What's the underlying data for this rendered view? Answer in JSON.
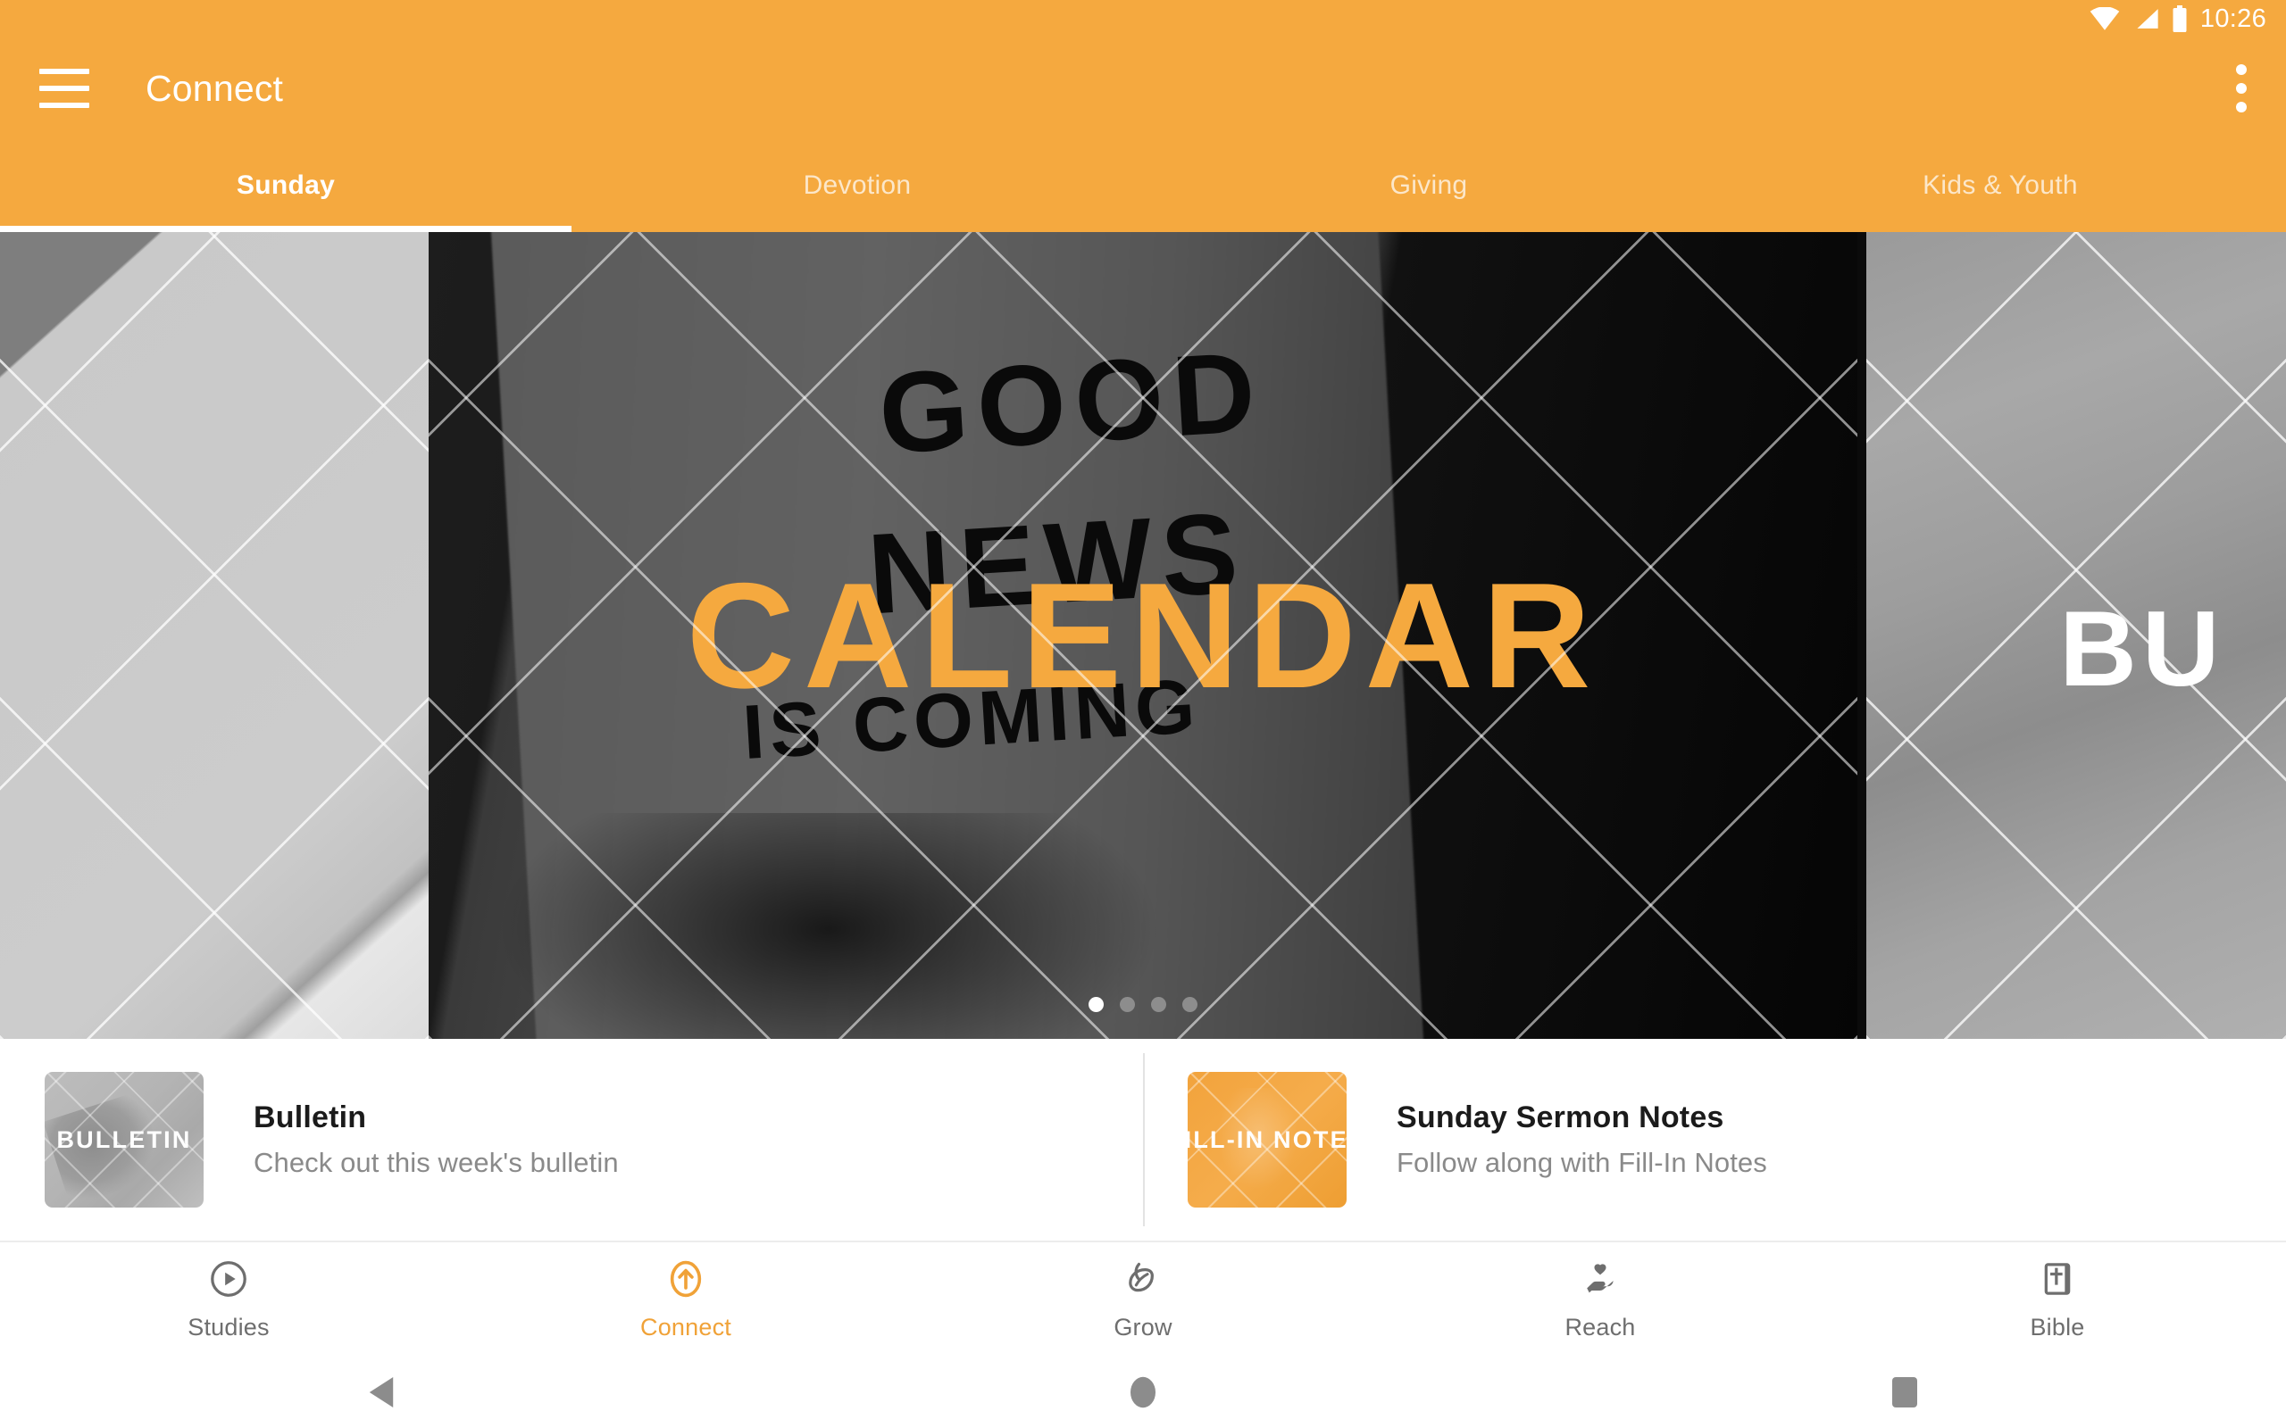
{
  "status_bar": {
    "time": "10:26",
    "icons": [
      "wifi-icon",
      "cell-signal-icon",
      "battery-icon"
    ]
  },
  "app_bar": {
    "menu_icon": "hamburger-menu-icon",
    "title": "Connect",
    "overflow_icon": "overflow-menu-icon"
  },
  "tabs": {
    "active_index": 0,
    "items": [
      {
        "label": "Sunday"
      },
      {
        "label": "Devotion"
      },
      {
        "label": "Giving"
      },
      {
        "label": "Kids & Youth"
      }
    ]
  },
  "hero": {
    "current_slide": 1,
    "total_slides": 4,
    "main_slide": {
      "headline": "CALENDAR",
      "background_text_line1": "GOOD",
      "background_text_line2": "NEWS",
      "background_text_line3": "IS COMING"
    },
    "next_slide": {
      "headline": "BU"
    },
    "dots": [
      {
        "active": true
      },
      {
        "active": false
      },
      {
        "active": false
      },
      {
        "active": false
      }
    ]
  },
  "cards": [
    {
      "thumb_label": "BULLETIN",
      "title": "Bulletin",
      "subtitle": "Check out this week's bulletin"
    },
    {
      "thumb_label": "FILL-IN NOTES",
      "title": "Sunday Sermon Notes",
      "subtitle": "Follow along with Fill-In Notes"
    }
  ],
  "bottom_nav": {
    "active_index": 1,
    "items": [
      {
        "label": "Studies",
        "icon": "play-circle-icon"
      },
      {
        "label": "Connect",
        "icon": "arrow-up-circle-icon"
      },
      {
        "label": "Grow",
        "icon": "leaf-icon"
      },
      {
        "label": "Reach",
        "icon": "hand-heart-icon"
      },
      {
        "label": "Bible",
        "icon": "book-cross-icon"
      }
    ]
  },
  "system_nav": {
    "back": "back-triangle-icon",
    "home": "home-circle-icon",
    "recents": "recents-square-icon"
  },
  "colors": {
    "brand_orange": "#F5A93F",
    "accent_orange": "#F0A238",
    "nav_inactive": "#6E6E6E",
    "card_title": "#1B1B1B",
    "card_subtitle": "#8A8A8A"
  }
}
